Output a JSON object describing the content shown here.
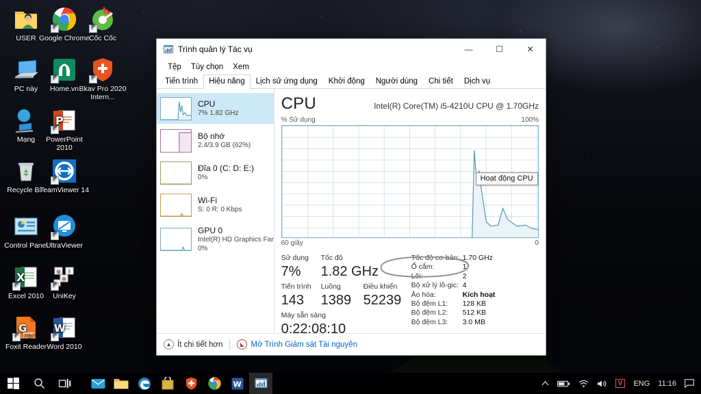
{
  "desktop": {
    "icons": [
      {
        "label": "USER",
        "icon": "user-folder-icon",
        "col": 0,
        "row": 0
      },
      {
        "label": "Google Chrome",
        "icon": "chrome-icon",
        "col": 1,
        "row": 0
      },
      {
        "label": "Cốc Cốc",
        "icon": "coccoc-icon",
        "col": 2,
        "row": 0
      },
      {
        "label": "PC này",
        "icon": "this-pc-icon",
        "col": 0,
        "row": 1
      },
      {
        "label": "Home.vn",
        "icon": "home-vn-icon",
        "col": 1,
        "row": 1
      },
      {
        "label": "Bkav Pro 2020 Intern...",
        "icon": "bkav-shield-icon",
        "col": 2,
        "row": 1
      },
      {
        "label": "Mạng",
        "icon": "network-icon",
        "col": 0,
        "row": 2
      },
      {
        "label": "PowerPoint 2010",
        "icon": "powerpoint-icon",
        "col": 1,
        "row": 2
      },
      {
        "label": "Recycle Bin",
        "icon": "recycle-bin-icon",
        "col": 0,
        "row": 3
      },
      {
        "label": "TeamViewer 14",
        "icon": "teamviewer-icon",
        "col": 1,
        "row": 3
      },
      {
        "label": "Control Panel",
        "icon": "control-panel-icon",
        "col": 0,
        "row": 4
      },
      {
        "label": "UltraViewer",
        "icon": "ultraviewer-icon",
        "col": 1,
        "row": 4
      },
      {
        "label": "Excel 2010",
        "icon": "excel-icon",
        "col": 0,
        "row": 5
      },
      {
        "label": "UniKey",
        "icon": "unikey-icon",
        "col": 1,
        "row": 5
      },
      {
        "label": "Foxit Reader",
        "icon": "foxit-reader-icon",
        "col": 0,
        "row": 6
      },
      {
        "label": "Word 2010",
        "icon": "word-icon",
        "col": 1,
        "row": 6
      }
    ]
  },
  "taskbar": {
    "buttons": [
      {
        "name": "start-button",
        "icon": "windows-logo-icon"
      },
      {
        "name": "search-button",
        "icon": "search-icon"
      },
      {
        "name": "task-view-button",
        "icon": "task-view-icon"
      }
    ],
    "apps": [
      {
        "name": "mail-app",
        "icon": "mail-icon",
        "active": false
      },
      {
        "name": "file-explorer-app",
        "icon": "folder-icon",
        "active": false
      },
      {
        "name": "edge-app",
        "icon": "edge-icon",
        "active": false
      },
      {
        "name": "store-app",
        "icon": "store-icon",
        "active": false
      },
      {
        "name": "bkav-app",
        "icon": "shield-icon",
        "active": false
      },
      {
        "name": "chrome-app",
        "icon": "chrome-icon",
        "active": false
      },
      {
        "name": "word-app",
        "icon": "word-icon",
        "active": false
      },
      {
        "name": "task-manager-app",
        "icon": "task-manager-icon",
        "active": true
      }
    ],
    "tray": {
      "show_hidden": "chevron-up-icon",
      "battery": "battery-icon",
      "network": "wifi-icon",
      "volume": "speaker-icon",
      "unikey": "V",
      "language": "ENG",
      "clock": "11:16",
      "action_center": "notification-icon"
    }
  },
  "task_manager": {
    "title": "Trình quản lý Tác vụ",
    "title_icon": "task-manager-icon",
    "window_buttons": {
      "minimize": "—",
      "maximize": "☐",
      "close": "✕"
    },
    "menu": [
      "Tệp",
      "Tùy chọn",
      "Xem"
    ],
    "tabs": [
      {
        "label": "Tiến trình",
        "active": false
      },
      {
        "label": "Hiệu năng",
        "active": true
      },
      {
        "label": "Lịch sử ứng dụng",
        "active": false
      },
      {
        "label": "Khởi động",
        "active": false
      },
      {
        "label": "Người dùng",
        "active": false
      },
      {
        "label": "Chi tiết",
        "active": false
      },
      {
        "label": "Dịch vụ",
        "active": false
      }
    ],
    "sidebar": [
      {
        "name": "CPU",
        "sub": "7% 1.82 GHz",
        "accent": "#3a8ab5",
        "selected": true
      },
      {
        "name": "Bộ nhớ",
        "sub": "2.4/3.9 GB (62%)",
        "accent": "#9a4f96",
        "selected": false
      },
      {
        "name": "Đĩa 0 (C: D: E:)",
        "sub": "0%",
        "accent": "#6f9b3f",
        "selected": false
      },
      {
        "name": "Wi-Fi",
        "sub": "S: 0 R: 0 Kbps",
        "accent": "#b5812e",
        "selected": false
      },
      {
        "name": "GPU 0",
        "sub2": "Intel(R) HD Graphics Far",
        "sub": "0%",
        "accent": "#3a8ab5",
        "selected": false
      }
    ],
    "detail": {
      "title": "CPU",
      "model": "Intel(R) Core(TM) i5-4210U CPU @ 1.70GHz",
      "graph_top_left": "% Sử dụng",
      "graph_top_right": "100%",
      "graph_bottom_left": "60 giây",
      "graph_bottom_right": "0",
      "tooltip": "Hoạt động CPU",
      "stats_left": [
        {
          "label": "Sử dụng",
          "value": "7%"
        },
        {
          "label": "Tốc độ",
          "value": "1.82 GHz"
        },
        {
          "label": "Tiến trình",
          "value": "143"
        },
        {
          "label": "Luồng",
          "value": "1389"
        },
        {
          "label": "Điều khiển",
          "value": "52239"
        },
        {
          "label": "Máy sẵn sàng",
          "value": "0:22:08:10"
        }
      ],
      "stats_right": [
        {
          "key": "Tốc độ cơ bản:",
          "value": "1.70 GHz"
        },
        {
          "key": "Ổ cắm:",
          "value": "1"
        },
        {
          "key": "Lõi:",
          "value": "2"
        },
        {
          "key": "Bộ xử lý lô-gic:",
          "value": "4"
        },
        {
          "key": "Ảo hóa:",
          "value": "Kích hoạt"
        },
        {
          "key": "Bộ đệm L1:",
          "value": "128 KB"
        },
        {
          "key": "Bộ đệm L2:",
          "value": "512 KB"
        },
        {
          "key": "Bộ đệm L3:",
          "value": "3.0 MB"
        }
      ],
      "annotation": "hand-drawn-ellipse-highlight"
    },
    "footer": {
      "fewer_details": "Ít chi tiết hơn",
      "resource_monitor": "Mở Trình Giám sát Tài nguyên"
    }
  },
  "chart_data": {
    "type": "area",
    "title": "% Sử dụng",
    "xlabel": "60 giây",
    "ylabel": "% Sử dụng",
    "ylim": [
      0,
      100
    ],
    "xlim": [
      60,
      0
    ],
    "grid": true,
    "series": [
      {
        "name": "Hoạt động CPU",
        "color": "#4a90ab",
        "fill": "#eaf3f8",
        "points": [
          {
            "t": 15.5,
            "v": 0
          },
          {
            "t": 15.0,
            "v": 78
          },
          {
            "t": 14.4,
            "v": 48
          },
          {
            "t": 13.9,
            "v": 60
          },
          {
            "t": 13.3,
            "v": 42
          },
          {
            "t": 12.2,
            "v": 14
          },
          {
            "t": 11.1,
            "v": 10
          },
          {
            "t": 9.4,
            "v": 11
          },
          {
            "t": 8.3,
            "v": 26
          },
          {
            "t": 7.2,
            "v": 16
          },
          {
            "t": 5.0,
            "v": 10
          },
          {
            "t": 3.0,
            "v": 11
          },
          {
            "t": 1.5,
            "v": 8
          },
          {
            "t": 0.0,
            "v": 7
          }
        ]
      }
    ]
  }
}
